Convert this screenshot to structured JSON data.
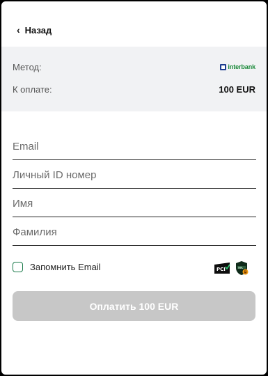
{
  "header": {
    "back_label": "Назад"
  },
  "summary": {
    "method_label": "Метод:",
    "method_logo_text": "interbank",
    "amount_label": "К оплате:",
    "amount_value": "100 EUR"
  },
  "form": {
    "email_placeholder": "Email",
    "personal_id_placeholder": "Личный ID номер",
    "first_name_placeholder": "Имя",
    "last_name_placeholder": "Фамилия",
    "remember_label": "Запомнить Email",
    "remember_checked": false
  },
  "badges": {
    "pci_icon": "pci-dss-badge-icon",
    "ssl_icon": "ssl-shield-icon"
  },
  "pay_button": {
    "label": "Оплатить 100 EUR",
    "enabled": false
  },
  "colors": {
    "summary_bg": "#f1f2f4",
    "button_disabled": "#c7c7c7",
    "checkbox_border": "#1a7a4a",
    "logo_blue": "#1d3d8f",
    "logo_green": "#1b8a3a"
  }
}
